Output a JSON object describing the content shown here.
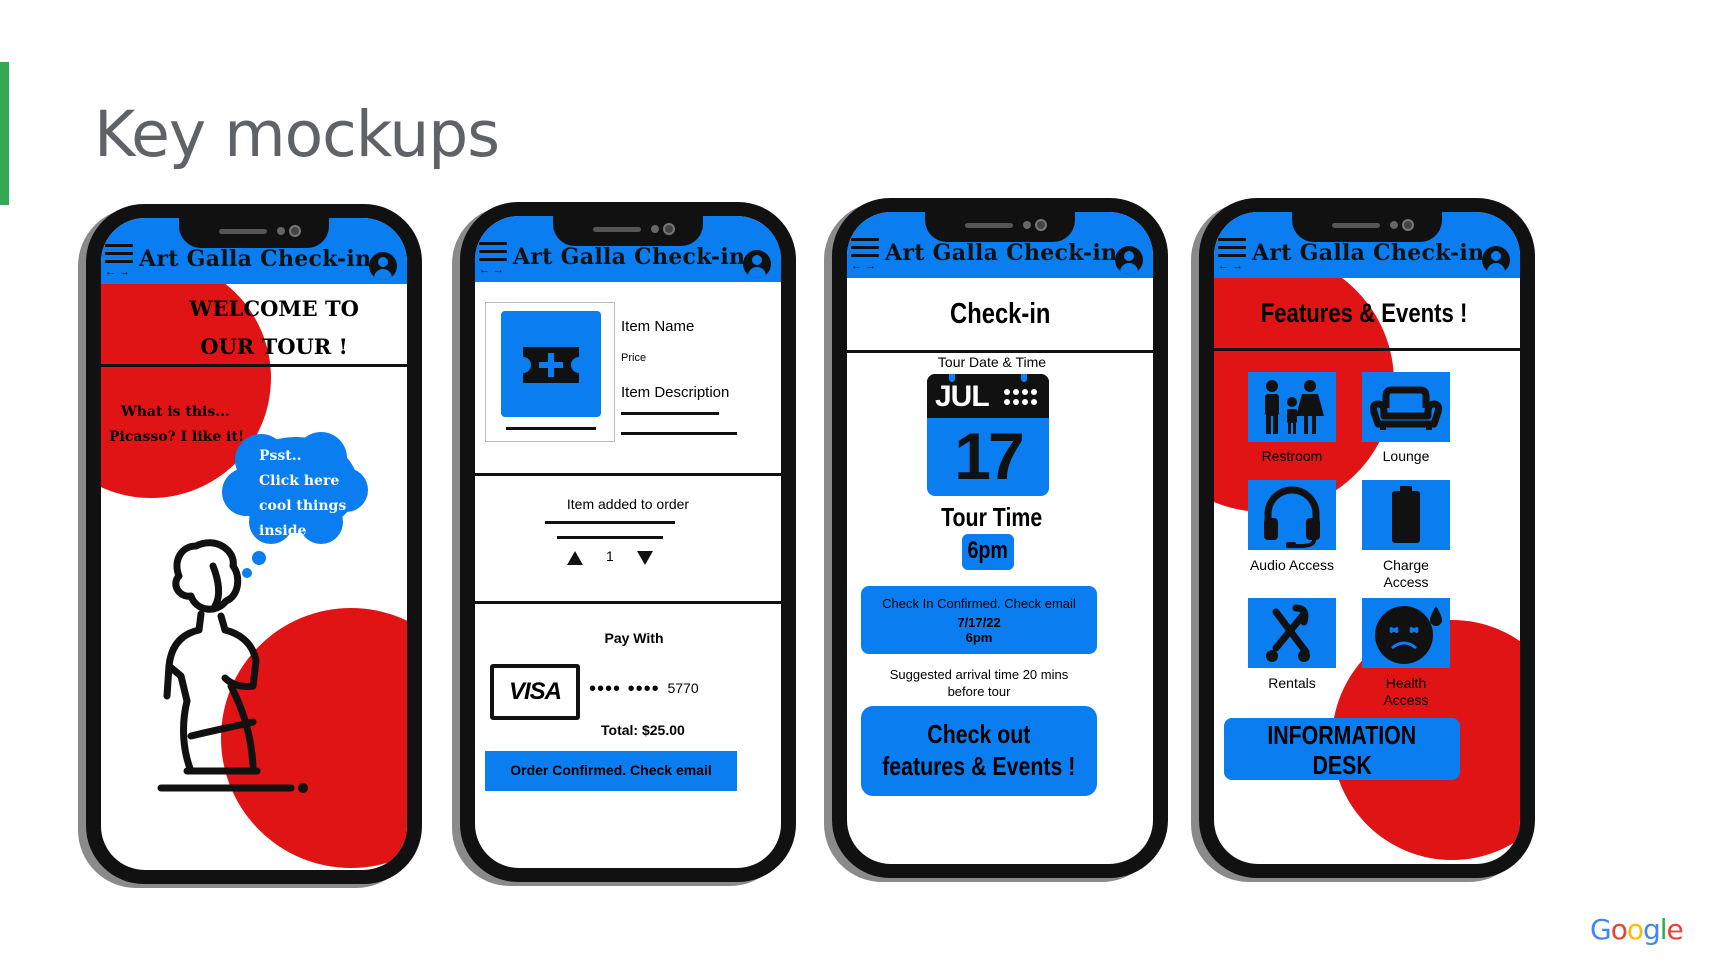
{
  "slide": {
    "title": "Key mockups",
    "logo": "Google",
    "accent_color": "#34a853"
  },
  "theme": {
    "primary_blue": "#0a7ef0",
    "accent_red": "#e01414"
  },
  "app": {
    "title": "Art Galla Check-in",
    "arrows": "← →",
    "menu_icon": "hamburger-icon",
    "account_icon": "account-circle-icon"
  },
  "screen1": {
    "welcome_line1": "WELCOME TO",
    "welcome_line2": "OUR TOUR !",
    "caption_line1": "What is this...",
    "caption_line2": "Picasso? I like it!",
    "bubble_lines": [
      "Psst..",
      "Click here",
      "cool things",
      "inside"
    ],
    "illustration": "statue-illustration"
  },
  "screen2": {
    "item_name": "Item Name",
    "price": "Price",
    "item_description": "Item Description",
    "added_text": "Item added to order",
    "quantity": "1",
    "pay_with": "Pay With",
    "card_brand": "VISA",
    "card_mask": "•••• ••••",
    "card_last4": "5770",
    "total": "Total: $25.00",
    "confirm_button": "Order Confirmed. Check email"
  },
  "screen3": {
    "heading": "Check-in",
    "date_time_label": "Tour Date &  Time",
    "calendar_month": "JUL",
    "calendar_day": "17",
    "tour_time_label": "Tour Time",
    "tour_time": "6pm",
    "confirm_line1": "Check In Confirmed. Check email",
    "confirm_line2": "7/17/22",
    "confirm_line3": "6pm",
    "arrival_line1": "Suggested arrival time 20 mins",
    "arrival_line2": "before tour",
    "cta_line1": "Check out",
    "cta_line2": "features & Events !"
  },
  "screen4": {
    "heading": "Features & Events !",
    "tiles": [
      {
        "label": "Restroom",
        "icon": "family-restroom-icon"
      },
      {
        "label": "Lounge",
        "icon": "sofa-icon"
      },
      {
        "label": "Audio Access",
        "icon": "headset-icon"
      },
      {
        "label_line1": "Charge",
        "label_line2": "Access",
        "icon": "battery-icon"
      },
      {
        "label": "Rentals",
        "icon": "stroller-icon"
      },
      {
        "label_line1": "Health",
        "label_line2": "Access",
        "icon": "sick-face-icon"
      }
    ],
    "info_line1": "INFORMATION",
    "info_line2": "DESK"
  }
}
